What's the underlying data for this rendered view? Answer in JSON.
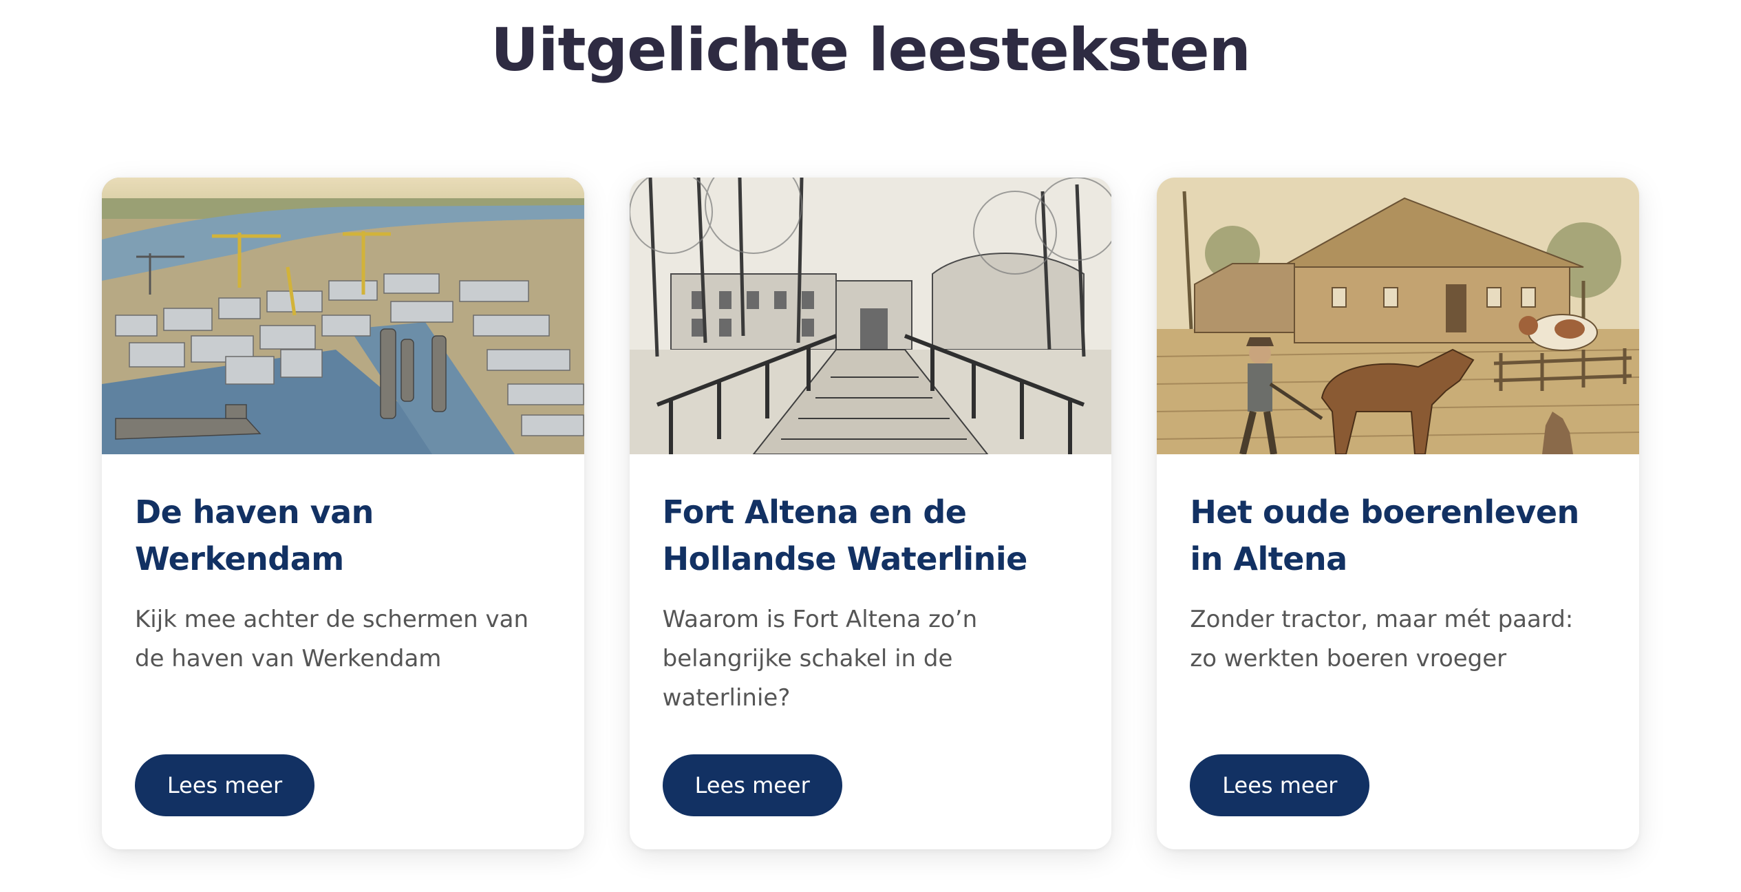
{
  "section": {
    "title": "Uitgelichte leesteksten"
  },
  "cards": [
    {
      "title": "De haven van Werkendam",
      "description": "Kijk mee achter de schermen van de haven van Werkendam",
      "button_label": "Lees meer",
      "image": "harbor-illustration"
    },
    {
      "title": "Fort Altena en de Hollandse Waterlinie",
      "description": "Waarom is Fort Altena zo’n belangrijke schakel in de waterlinie?",
      "button_label": "Lees meer",
      "image": "fort-bridge-sketch"
    },
    {
      "title": "Het oude boerenleven in Altena",
      "description": "Zonder tractor, maar mét paard: zo werkten boeren vroeger",
      "button_label": "Lees meer",
      "image": "farm-illustration"
    }
  ],
  "colors": {
    "heading": "#2e2b42",
    "card_title": "#123163",
    "button_bg": "#123163",
    "button_text": "#ffffff",
    "body_text": "#555555"
  }
}
